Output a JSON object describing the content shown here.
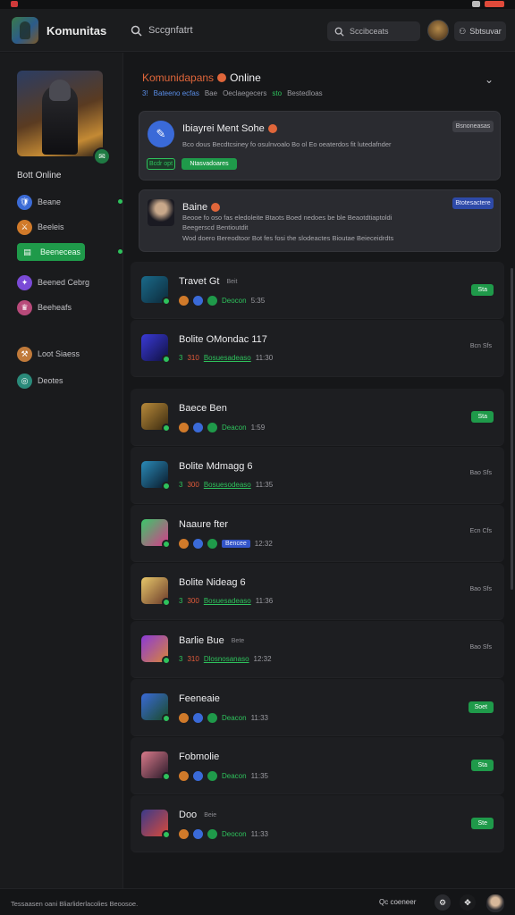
{
  "app": {
    "title": "Komunitas"
  },
  "header": {
    "search_label": "Sccgnfatrt",
    "search2_placeholder": "Sccibceats",
    "button_label": "Sbtsuvar"
  },
  "sidebar": {
    "heading": "Bott Online",
    "items": [
      {
        "label": "Beane",
        "color": "#3b6bd6",
        "active": false,
        "dot": true
      },
      {
        "label": "Beeleis",
        "color": "#d07a2a",
        "active": false,
        "dot": false
      },
      {
        "label": "Beeneceas",
        "color": "#1f9a4a",
        "active": true,
        "dot": true
      },
      {
        "label": "Beened Cebrg",
        "color": "#7a4ad6",
        "active": false,
        "dot": false
      },
      {
        "label": "Beeheafs",
        "color": "#b84a7a",
        "active": false,
        "dot": false
      },
      {
        "label": "Loot Siaess",
        "color": "#c07a3a",
        "active": false,
        "dot": false
      },
      {
        "label": "Deotes",
        "color": "#2a8a7a",
        "active": false,
        "dot": false
      }
    ]
  },
  "main": {
    "title_a": "Komunidapans",
    "title_b": "Online",
    "sub": [
      "3!",
      "Bateeno ecfas",
      "Bae",
      "Oeclaegecers",
      "sto",
      "Bestedloas"
    ]
  },
  "cards": [
    {
      "title": "Ibiayrei Ment Sohe",
      "line1": "Bco dous Becdtcsiney fo osulnvoalo Bo ol Eo oeaterdos fit lutedafnder",
      "line2": "",
      "pill_a": "Bcdr opt",
      "pill_b": "Ntasvadoares",
      "corner": "Bsnoneasas"
    },
    {
      "title": "Baine",
      "line1": "Beooe fo oso fas eledoleite Btaots Boed nedoes be ble Beaotdtiaptoldi",
      "line2": "Beegerscd Bentioutdit",
      "line3": "Wod doero Bereodtoor Bot fes fosi the slodeactes Bioutae Beieceidrdts",
      "corner": "Btotesactere"
    }
  ],
  "rows": [
    {
      "name": "Travet Gt",
      "tag": "Beit",
      "time": "5:35",
      "status": "Deocon",
      "button": "Sta",
      "right": "",
      "num": "",
      "extra": ""
    },
    {
      "name": "Bolite OMondac 117",
      "tag": "",
      "time": "11:30",
      "status": "Bosuesadeaso",
      "button": "",
      "right": "Bcn Sfs",
      "num": "3",
      "extra": "310"
    },
    {
      "name": "Baece Ben",
      "tag": "",
      "time": "1:59",
      "status": "Deacon",
      "button": "Sta",
      "right": "",
      "num": "",
      "extra": ""
    },
    {
      "name": "Bolite Mdmagg 6",
      "tag": "",
      "time": "11:35",
      "status": "Bosuesodeaso",
      "button": "",
      "right": "Bao Sfs",
      "num": "3",
      "extra": "300"
    },
    {
      "name": "Naaure fter",
      "tag": "",
      "time": "12:32",
      "status": "Bencee",
      "button": "",
      "right": "Ecn Cfs",
      "num": "",
      "extra": ""
    },
    {
      "name": "Bolite Nideag 6",
      "tag": "",
      "time": "11:36",
      "status": "Bosuesadeaso",
      "button": "",
      "right": "Bao Sfs",
      "num": "3",
      "extra": "300"
    },
    {
      "name": "Barlie Bue",
      "tag": "Bete",
      "time": "12:32",
      "status": "Dlosnosanaso",
      "button": "",
      "right": "Bao Sfs",
      "num": "3",
      "extra": "310"
    },
    {
      "name": "Feeneaie",
      "tag": "",
      "time": "11:33",
      "status": "Deacon",
      "button": "Soet",
      "right": "",
      "num": "",
      "extra": ""
    },
    {
      "name": "Fobmolie",
      "tag": "",
      "time": "11:35",
      "status": "Deacon",
      "button": "Sta",
      "right": "",
      "num": "",
      "extra": ""
    },
    {
      "name": "Doo",
      "tag": "Beie",
      "time": "11:33",
      "status": "Deocon",
      "button": "Ste",
      "right": "",
      "num": "",
      "extra": ""
    }
  ],
  "footer": {
    "text": "Tessaasen oani Bliarliderlacolies Beoosoe.",
    "link": "Qc coeneer"
  }
}
